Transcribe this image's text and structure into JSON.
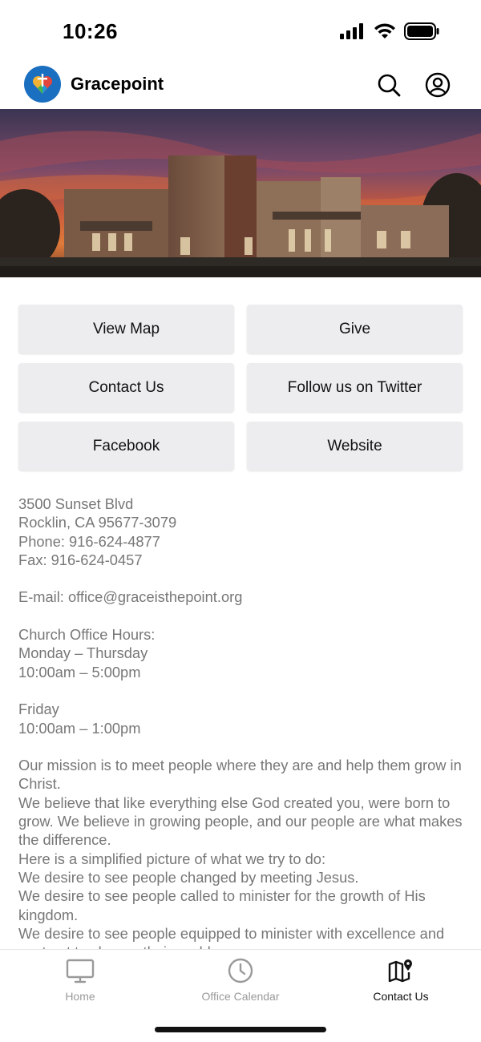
{
  "status_bar": {
    "time": "10:26"
  },
  "header": {
    "title": "Gracepoint"
  },
  "buttons": [
    {
      "label": "View Map"
    },
    {
      "label": "Give"
    },
    {
      "label": "Contact Us"
    },
    {
      "label": "Follow us on Twitter"
    },
    {
      "label": "Facebook"
    },
    {
      "label": "Website"
    }
  ],
  "info": {
    "address_1": "3500 Sunset Blvd",
    "address_2": "Rocklin, CA 95677-3079",
    "phone": "Phone: 916-624-4877",
    "fax": "Fax: 916-624-0457",
    "email": "E-mail: office@graceisthepoint.org",
    "hours_title": "Church Office Hours:",
    "hours_days_1": "Monday – Thursday",
    "hours_time_1": "10:00am – 5:00pm",
    "hours_days_2": "Friday",
    "hours_time_2": "10:00am – 1:00pm",
    "mission_1": "Our mission is to meet people where they are and help them grow in Christ.",
    "mission_2": "We believe that like everything else God created you, were born to grow. We believe in growing people, and our people are what makes the difference.",
    "mission_3": "Here is a simplified picture of what we try to do:",
    "mission_4": "We desire to see people changed by meeting Jesus.",
    "mission_5": "We desire to see people called to minister for the growth of His kingdom.",
    "mission_6": "We desire to see people equipped to minister with excellence and sent out to change their world."
  },
  "tabs": [
    {
      "label": "Home",
      "icon": "monitor-icon"
    },
    {
      "label": "Office Calendar",
      "icon": "clock-icon"
    },
    {
      "label": "Contact Us",
      "icon": "map-pin-icon",
      "active": true
    }
  ]
}
